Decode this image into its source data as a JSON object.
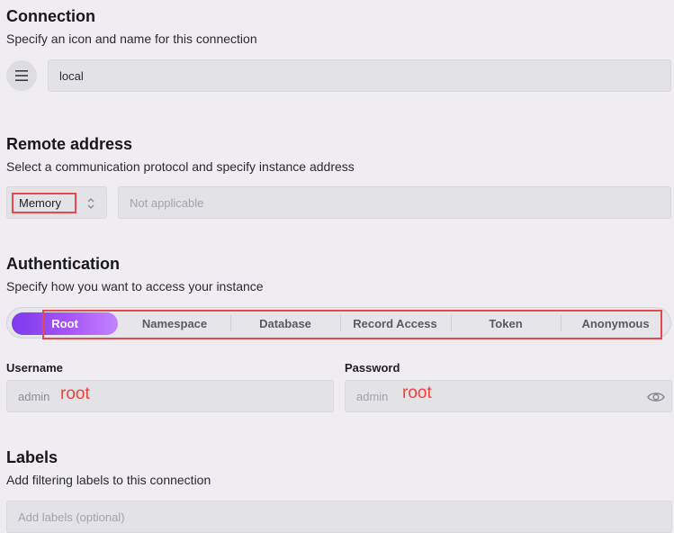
{
  "connection": {
    "title": "Connection",
    "description": "Specify an icon and name for this connection",
    "icon": "menu-icon",
    "name_value": "local"
  },
  "remote": {
    "title": "Remote address",
    "description": "Select a communication protocol and specify instance address",
    "protocol_value": "Memory",
    "address_placeholder": "Not applicable"
  },
  "auth": {
    "title": "Authentication",
    "description": "Specify how you want to access your instance",
    "tabs": [
      {
        "label": "Root"
      },
      {
        "label": "Namespace"
      },
      {
        "label": "Database"
      },
      {
        "label": "Record Access"
      },
      {
        "label": "Token"
      },
      {
        "label": "Anonymous"
      }
    ],
    "username_label": "Username",
    "username_placeholder": "admin",
    "username_annotation": "root",
    "password_label": "Password",
    "password_placeholder": "admin",
    "password_annotation": "root"
  },
  "labels": {
    "title": "Labels",
    "description": "Add filtering labels to this connection",
    "placeholder": "Add labels (optional)"
  },
  "colors": {
    "accent_gradient_start": "#7c3aed",
    "accent_gradient_end": "#c084fc",
    "annotation_red": "#e5484d"
  }
}
